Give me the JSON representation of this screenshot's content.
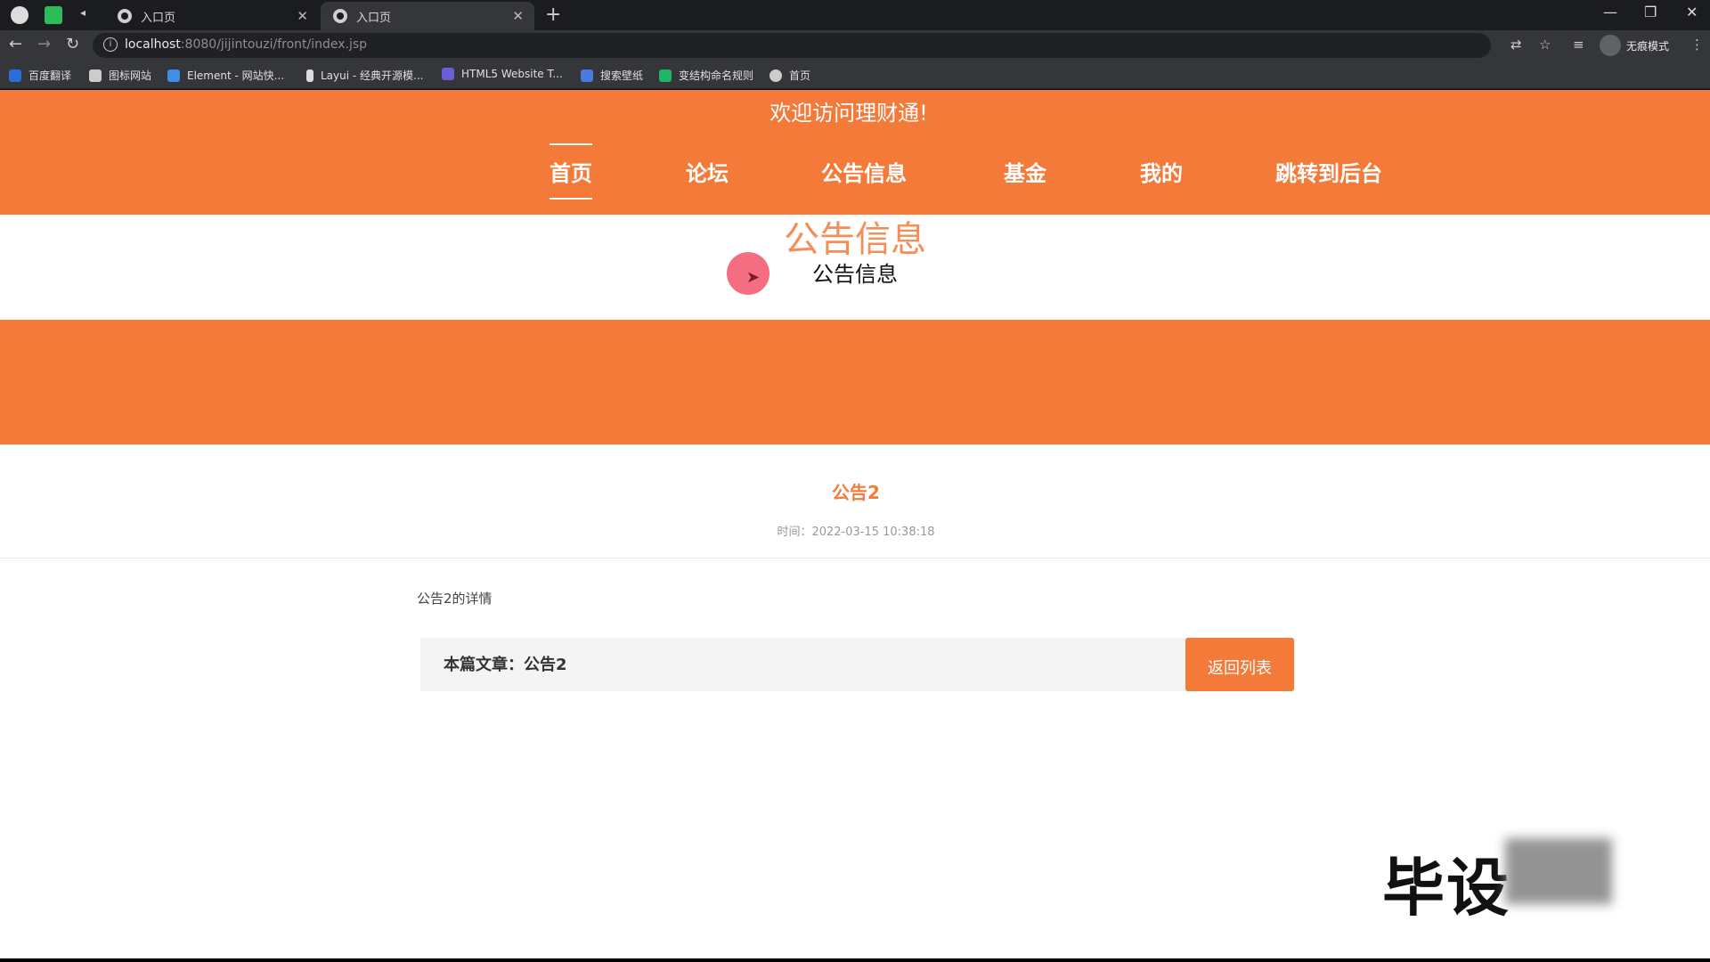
{
  "browser": {
    "tabs": [
      {
        "title": "入口页",
        "active": false
      },
      {
        "title": "入口页",
        "active": true
      }
    ],
    "new_tab": "+",
    "window_controls": {
      "minimize": "—",
      "restore": "❐",
      "close": "✕"
    },
    "nav": {
      "back": "←",
      "forward": "→",
      "reload": "↻"
    },
    "url": {
      "host": "localhost",
      "path": ":8080/jijintouzi/front/index.jsp"
    },
    "profile_label": "无痕模式",
    "bookmarks": [
      {
        "label": "百度翻译",
        "color": "#2a6ed8"
      },
      {
        "label": "图标网站",
        "color": "#cccccc"
      },
      {
        "label": "Element - 网站快...",
        "color": "#3f8ee8"
      },
      {
        "label": "Layui - 经典开源模...",
        "color": "#dddddd"
      },
      {
        "label": "HTML5 Website T...",
        "color": "#6b5fd9"
      },
      {
        "label": "搜索壁纸",
        "color": "#4a7ae0"
      },
      {
        "label": "变结构命名规则",
        "color": "#24b36b"
      },
      {
        "label": "首页",
        "color": "#cccccc"
      }
    ]
  },
  "site": {
    "welcome": "欢迎访问理财通!",
    "nav": [
      "首页",
      "论坛",
      "公告信息",
      "基金",
      "我的",
      "跳转到后台"
    ],
    "active_nav": "首页",
    "accent_color": "#f47a3a"
  },
  "section": {
    "title_large": "公告信息",
    "title": "公告信息"
  },
  "article": {
    "title": "公告2",
    "meta": "时间：2022-03-15 10:38:18",
    "body": "公告2的详情",
    "footer_text": "本篇文章：公告2",
    "back_button": "返回列表"
  },
  "watermark": "毕设"
}
